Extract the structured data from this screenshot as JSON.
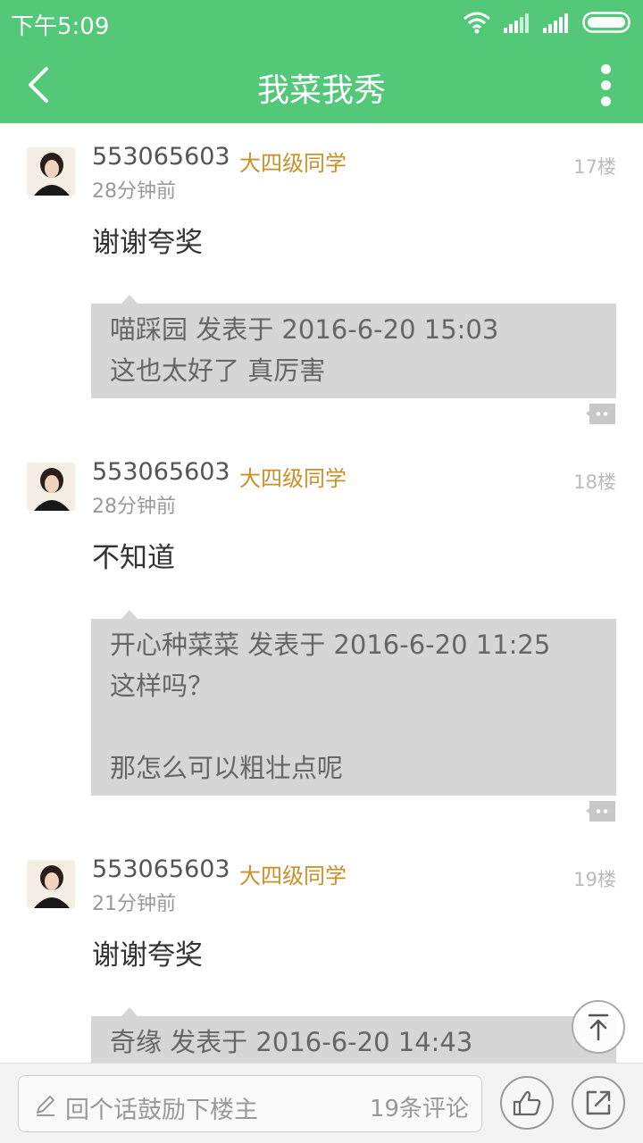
{
  "status_bar": {
    "time": "下午5:09"
  },
  "app_bar": {
    "title": "我菜我秀"
  },
  "posts": [
    {
      "username": "553065603",
      "level": "大四级同学",
      "time": "28分钟前",
      "floor": "17楼",
      "content": "谢谢夸奖",
      "quote": {
        "header": "喵踩园 发表于 2016-6-20 15:03",
        "lines": [
          "这也太好了 真厉害"
        ]
      }
    },
    {
      "username": "553065603",
      "level": "大四级同学",
      "time": "28分钟前",
      "floor": "18楼",
      "content": "不知道",
      "quote": {
        "header": "开心种菜菜 发表于 2016-6-20 11:25",
        "lines": [
          "这样吗？",
          "",
          "那怎么可以粗壮点呢"
        ]
      }
    },
    {
      "username": "553065603",
      "level": "大四级同学",
      "time": "21分钟前",
      "floor": "19楼",
      "content": "谢谢夸奖",
      "quote": {
        "header": "奇缘 发表于 2016-6-20 14:43",
        "lines": []
      }
    }
  ],
  "bottom_bar": {
    "placeholder": "回个话鼓励下楼主",
    "comment_count": "19条评论"
  },
  "colors": {
    "accent": "#52c878",
    "level": "#c9902a",
    "quote_bg": "#d6d6d6"
  },
  "icons": [
    "back-arrow-icon",
    "more-vertical-icon",
    "reply-bubble-icon",
    "arrow-up-icon",
    "pen-icon",
    "thumbs-up-icon",
    "share-icon"
  ]
}
